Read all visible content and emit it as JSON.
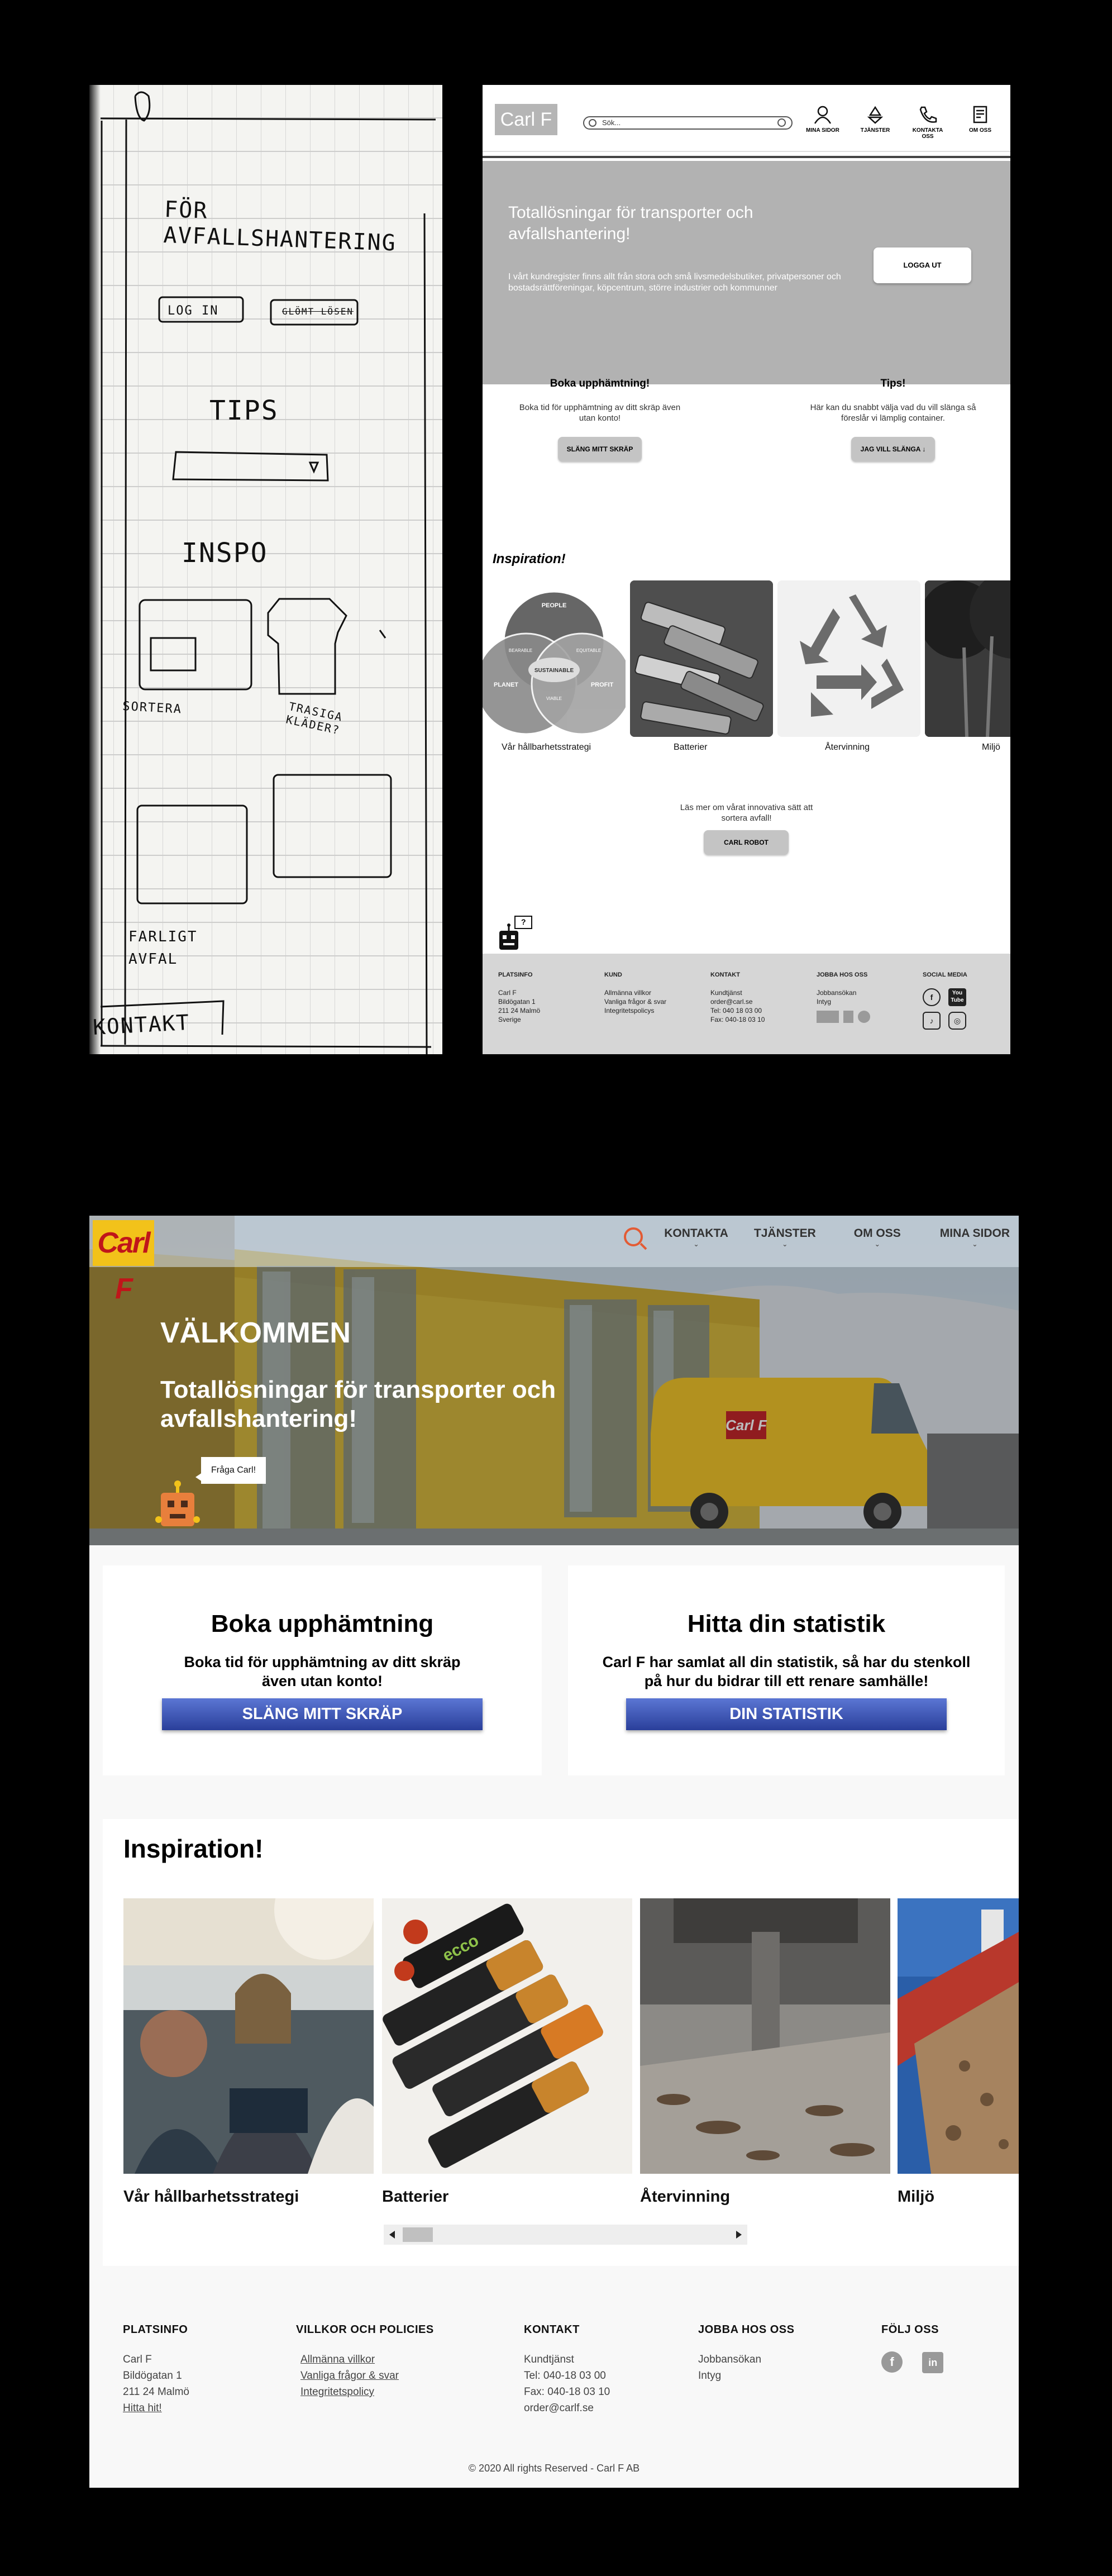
{
  "sketch": {
    "title": "FÖR AVFALLSHANTERING",
    "login": "LOG IN",
    "glomt": "GLÖMT LÖSEN",
    "tips": "TIPS",
    "inspo": "INSPO",
    "sortera": "SORTERA",
    "trasiga": "TRASIGA KLÄDER?",
    "farligt": "FARLIGT AVFAL",
    "kontakt": "KONTAKT"
  },
  "wireframe": {
    "logo": "Carl F",
    "search_placeholder": "Sök...",
    "nav": [
      {
        "label": "MINA SIDOR",
        "icon": "user-icon"
      },
      {
        "label": "TJÄNSTER",
        "icon": "recycle-icon"
      },
      {
        "label": "KONTAKTA OSS",
        "icon": "phone-icon"
      },
      {
        "label": "OM OSS",
        "icon": "document-icon"
      }
    ],
    "hero_title": "Totallösningar för transporter och avfallshantering!",
    "hero_text": "I vårt kundregister finns allt från stora och små livsmedelsbutiker, privatpersoner och bostadsrättföreningar, köpcentrum, större industrier och kommunner",
    "logout_label": "LOGGA UT",
    "col1": {
      "title": "Boka upphämtning!",
      "text": "Boka tid för upphämtning av ditt skräp även utan konto!",
      "button": "SLÄNG MITT SKRÄP"
    },
    "col2": {
      "title": "Tips!",
      "text": "Här kan du snabbt välja vad du vill slänga så föreslår vi lämplig container.",
      "button": "JAG VILL SLÄNGA ↓"
    },
    "inspiration_title": "Inspiration!",
    "venn": {
      "top": "PEOPLE",
      "left": "PLANET",
      "right": "PROFIT",
      "center": "SUSTAINABLE",
      "lr": "BEARABLE",
      "rr": "EQUITABLE",
      "bb": "VIABLE"
    },
    "cards": [
      "Vår hållbarhetsstrategi",
      "Batterier",
      "Återvinning",
      "Miljö"
    ],
    "robot_text": "Läs mer om vårat innovativa sätt att sortera avfall!",
    "robot_button": "CARL ROBOT",
    "robot_bubble": "?",
    "footer": {
      "platsinfo": {
        "title": "PLATSINFO",
        "lines": [
          "Carl F",
          "Bildögatan 1",
          "211 24 Malmö",
          "Sverige"
        ]
      },
      "kund": {
        "title": "KUND",
        "lines": [
          "Allmänna villkor",
          "Vanliga frågor & svar",
          "Integritetspolicys"
        ]
      },
      "kontakt": {
        "title": "KONTAKT",
        "lines": [
          "Kundtjänst",
          "order@carl.se",
          "Tel: 040 18 03 00",
          "Fax: 040-18 03 10"
        ]
      },
      "jobba": {
        "title": "JOBBA HOS OSS",
        "lines": [
          "Jobbansökan",
          "Intyg"
        ]
      },
      "social": {
        "title": "SOCIAL MEDIA",
        "icons": [
          "facebook-icon",
          "youtube-icon",
          "tiktok-icon",
          "instagram-icon"
        ],
        "youtube": "You Tube"
      }
    }
  },
  "mockup": {
    "logo": "Carl F",
    "nav": [
      "KONTAKTA",
      "TJÄNSTER",
      "OM OSS",
      "MINA SIDOR"
    ],
    "hero_welcome": "VÄLKOMMEN",
    "hero_title": "Totallösningar för transporter och avfallshantering!",
    "chat_label": "Fråga Carl!",
    "van_logo": "Carl F",
    "card1": {
      "title": "Boka upphämtning",
      "text": "Boka tid för upphämtning av ditt skräp även utan konto!",
      "button": "SLÄNG MITT SKRÄP"
    },
    "card2": {
      "title": "Hitta din statistik",
      "text": "Carl F har samlat all din statistik, så har du stenkoll på hur du bidrar till ett renare samhälle!",
      "button": "DIN STATISTIK"
    },
    "inspiration_title": "Inspiration!",
    "cards": [
      "Vår hållbarhetsstrategi",
      "Batterier",
      "Återvinning",
      "Miljö"
    ],
    "battery_brand": "ecco",
    "footer": {
      "platsinfo": {
        "title": "PLATSINFO",
        "lines": [
          "Carl F",
          "Bildögatan 1",
          "211 24 Malmö"
        ],
        "link": "Hitta hit!"
      },
      "villkor": {
        "title": "VILLKOR OCH POLICIES",
        "links": [
          "Allmänna villkor",
          "Vanliga frågor & svar",
          "Integritetspolicy"
        ]
      },
      "kontakt": {
        "title": "KONTAKT",
        "lines": [
          "Kundtjänst",
          "Tel: 040-18 03 00",
          "Fax: 040-18 03 10",
          "order@carlf.se"
        ]
      },
      "jobba": {
        "title": "JOBBA HOS OSS",
        "lines": [
          "Jobbansökan",
          "Intyg"
        ]
      },
      "folj": {
        "title": "FÖLJ OSS",
        "icons": [
          "facebook-icon",
          "linkedin-icon"
        ],
        "facebook_glyph": "f",
        "linkedin_glyph": "in"
      }
    },
    "copyright": "© 2020 All rights Reserved - Carl F AB"
  }
}
